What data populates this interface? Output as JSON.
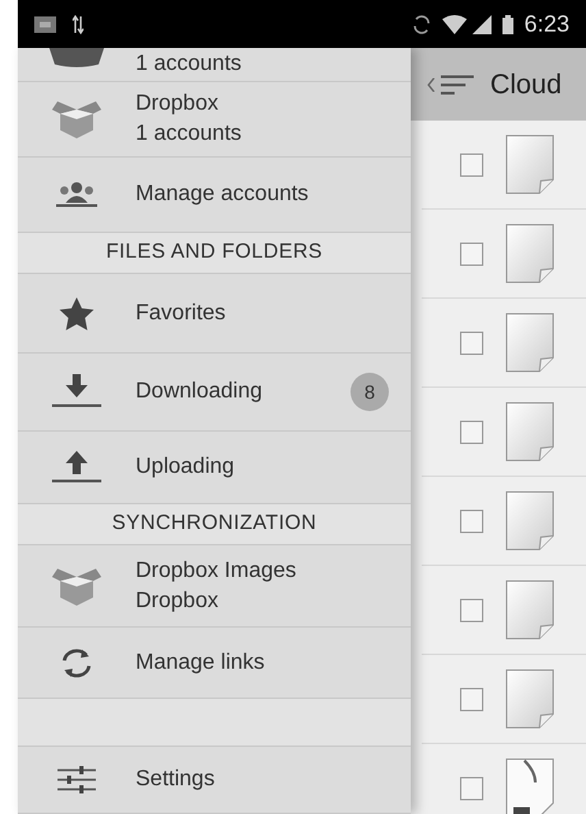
{
  "status_bar": {
    "time": "6:23"
  },
  "drawer": {
    "items": [
      {
        "kind": "account",
        "lines": [
          "1 accounts"
        ]
      },
      {
        "kind": "account",
        "lines": [
          "Dropbox",
          "1 accounts"
        ]
      },
      {
        "kind": "item",
        "label": "Manage accounts"
      },
      {
        "kind": "header",
        "label": "FILES AND FOLDERS"
      },
      {
        "kind": "item",
        "label": "Favorites"
      },
      {
        "kind": "item",
        "label": "Downloading",
        "badge": "8"
      },
      {
        "kind": "item",
        "label": "Uploading"
      },
      {
        "kind": "header",
        "label": "SYNCHRONIZATION"
      },
      {
        "kind": "account",
        "lines": [
          "Dropbox Images",
          "Dropbox"
        ]
      },
      {
        "kind": "item",
        "label": "Manage links"
      },
      {
        "kind": "spacer"
      },
      {
        "kind": "item",
        "label": "Settings"
      }
    ]
  },
  "panel": {
    "title": "Cloud",
    "rows": [
      {
        "kind": "document",
        "checked": false
      },
      {
        "kind": "document",
        "checked": false
      },
      {
        "kind": "document",
        "checked": false
      },
      {
        "kind": "document",
        "checked": false
      },
      {
        "kind": "document",
        "checked": false
      },
      {
        "kind": "document",
        "checked": false
      },
      {
        "kind": "document",
        "checked": false
      },
      {
        "kind": "archive",
        "checked": false
      }
    ]
  }
}
